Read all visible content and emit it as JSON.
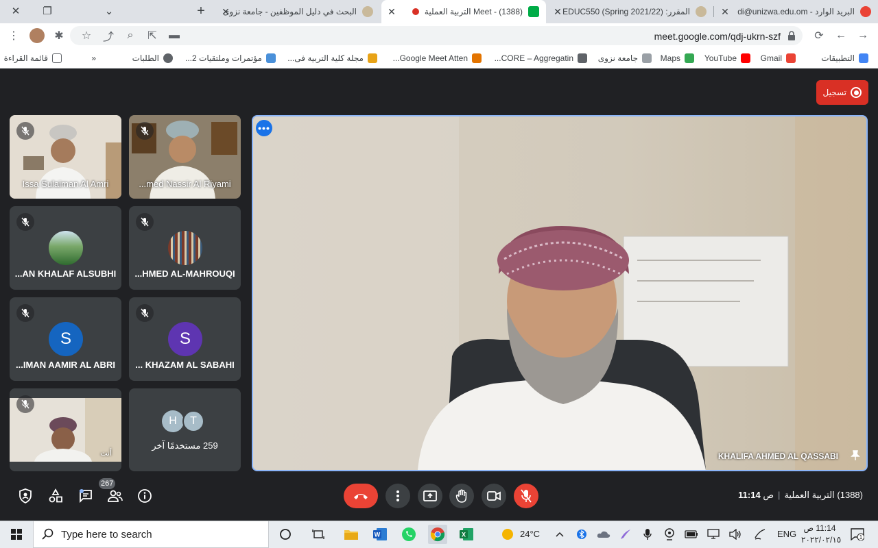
{
  "browser": {
    "tabs": [
      {
        "title": "البريد الوارد - di@unizwa.edu.om",
        "active": false
      },
      {
        "title": "المقرر: EDUC550 (Spring 2021/22)",
        "active": false
      },
      {
        "title": "Meet - (1388) التربية العملية",
        "active": true
      },
      {
        "title": "البحث في دليل الموظفين - جامعة نزوى",
        "active": false
      }
    ],
    "url": "meet.google.com/qdj-ukrn-szf",
    "bookmarks": [
      {
        "label": "التطبيقات",
        "color": "#4285f4"
      },
      {
        "label": "Gmail",
        "color": "#ea4335"
      },
      {
        "label": "YouTube",
        "color": "#ff0000"
      },
      {
        "label": "Maps",
        "color": "#34a853"
      },
      {
        "label": "جامعة نزوى",
        "color": "#9aa0a6"
      },
      {
        "label": "CORE – Aggregatin...",
        "color": "#5f6368"
      },
      {
        "label": "Google Meet Atten...",
        "color": "#e37400"
      },
      {
        "label": "مجلة كلية التربية فى...",
        "color": "#e8a317"
      },
      {
        "label": "مؤتمرات وملتقيات 2...",
        "color": "#4a90d9"
      },
      {
        "label": "الطلبات",
        "color": "#5f6368"
      }
    ],
    "reading_list": "قائمة القراءة"
  },
  "meet": {
    "record_label": "تسجيل",
    "participants": [
      {
        "name": "Issa Sulaiman Al Amri",
        "type": "video"
      },
      {
        "name": "...med Nassir Al Riyami",
        "type": "video"
      },
      {
        "name": "...AN KHALAF ALSUBHI",
        "type": "photo"
      },
      {
        "name": "...HMED AL-MAHROUQI",
        "type": "photo"
      },
      {
        "name": "...IMAN AAMIR AL ABRI",
        "type": "letter",
        "letter": "S",
        "color": "#1565c0"
      },
      {
        "name": "... KHAZAM AL SABAHI",
        "type": "letter",
        "letter": "S",
        "color": "#5e35b1"
      },
      {
        "name": "أنت",
        "type": "video"
      }
    ],
    "others": {
      "letters": [
        "H",
        "T"
      ],
      "label": "259 مستخدمًا آخر"
    },
    "main_speaker": "KHALIFA AHMED AL QASSABI",
    "people_count": "267",
    "time": "11:14",
    "ampm": "ص",
    "meeting_name": "(1388) التربية العملية"
  },
  "taskbar": {
    "search_placeholder": "Type here to search",
    "weather": "24°C",
    "lang": "ENG",
    "time": "11:14 ص",
    "date": "٢٠٢٢/٠٢/١٥",
    "notif": "1"
  }
}
